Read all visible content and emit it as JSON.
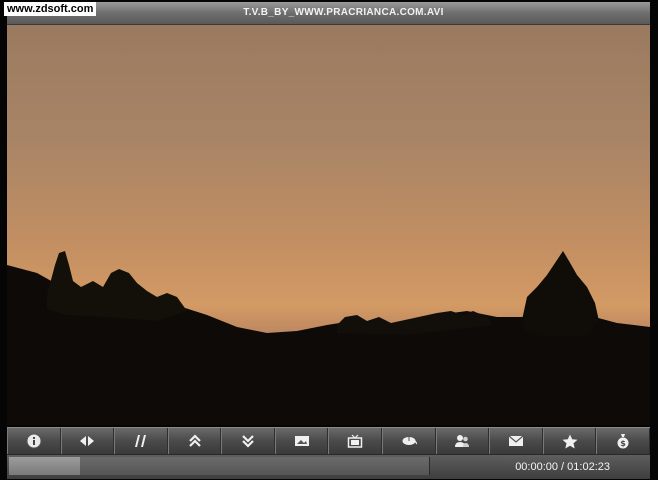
{
  "watermark": "www.zdsoft.com",
  "title": "T.V.B_BY_WWW.PRACRIANCA.COM.AVI",
  "controls": [
    {
      "name": "info-button",
      "icon": "info-icon"
    },
    {
      "name": "prev-next-button",
      "icon": "arrows-left-right-icon"
    },
    {
      "name": "pause-button",
      "icon": "pause-icon"
    },
    {
      "name": "scroll-up-button",
      "icon": "double-chevron-up-icon"
    },
    {
      "name": "scroll-down-button",
      "icon": "double-chevron-down-icon"
    },
    {
      "name": "screenshot-button",
      "icon": "picture-icon"
    },
    {
      "name": "tv-button",
      "icon": "tv-icon"
    },
    {
      "name": "mouse-button",
      "icon": "mouse-icon"
    },
    {
      "name": "users-button",
      "icon": "users-icon"
    },
    {
      "name": "mail-button",
      "icon": "mail-icon"
    },
    {
      "name": "favorite-button",
      "icon": "star-icon"
    },
    {
      "name": "money-button",
      "icon": "money-bag-icon"
    }
  ],
  "playback": {
    "current_time": "00:00:00",
    "total_time": "01:02:23",
    "time_display": "00:00:00 / 01:02:23",
    "progress_fraction": 0.17
  },
  "colors": {
    "sky": "#c38f62",
    "toolbar": "#4a4a4a"
  }
}
